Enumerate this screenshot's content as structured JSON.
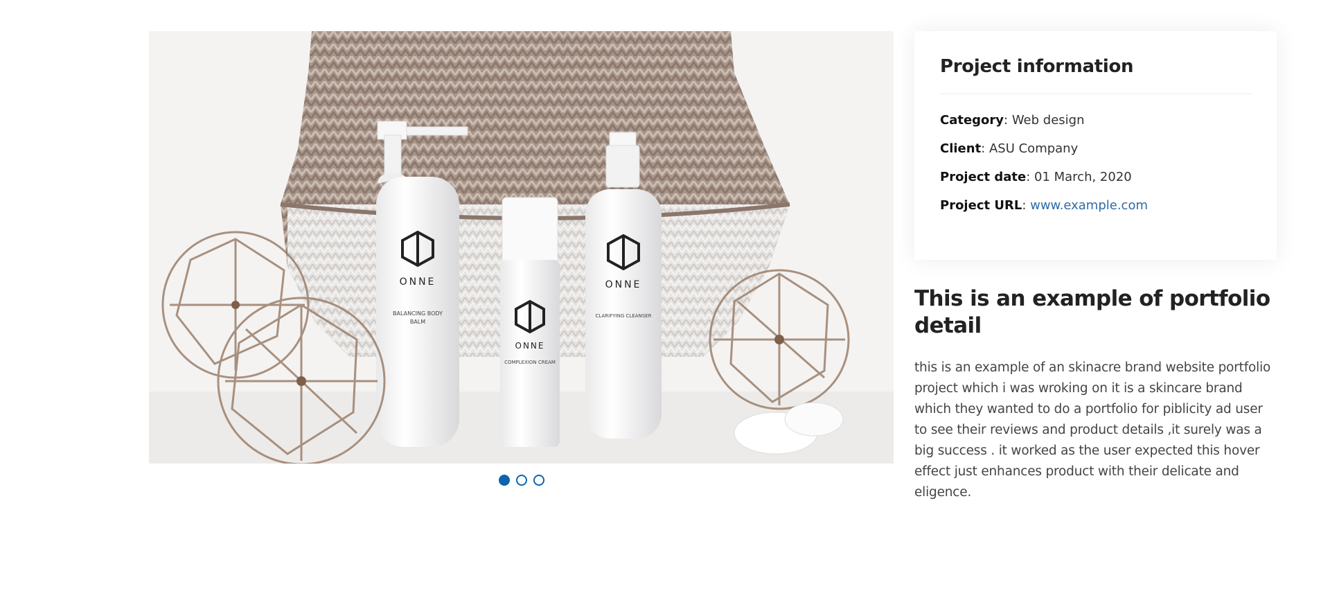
{
  "slider": {
    "image_description": "skincare-products-photo",
    "brand_text": "ONNE",
    "product_labels": [
      "BALANCING BODY BALM",
      "COMPLEXION CREAM",
      "CLARIFYING CLEANSER"
    ],
    "slide_count": 3,
    "active_slide": 1,
    "dot_labels": [
      "1",
      "2",
      "3"
    ]
  },
  "project_info": {
    "title": "Project information",
    "category_label": "Category",
    "category_value": ": Web design",
    "client_label": "Client",
    "client_value": ": ASU Company",
    "date_label": "Project date",
    "date_value": ": 01 March, 2020",
    "url_label": "Project URL",
    "url_separator": ": ",
    "url_value": "www.example.com"
  },
  "description": {
    "title": "This is an example of portfolio detail",
    "text": "this is an example of an skinacre brand website portfolio project which i was wroking on it is a skincare brand which they wanted to do a portfolio for piblicity ad user to see their reviews and product details ,it surely was a big success . it worked as the user expected this hover effect just enhances product with their delicate and eligence."
  },
  "colors": {
    "accent": "#0d63b0",
    "link": "#2f6aa8",
    "heading": "#222222",
    "text": "#444444"
  }
}
